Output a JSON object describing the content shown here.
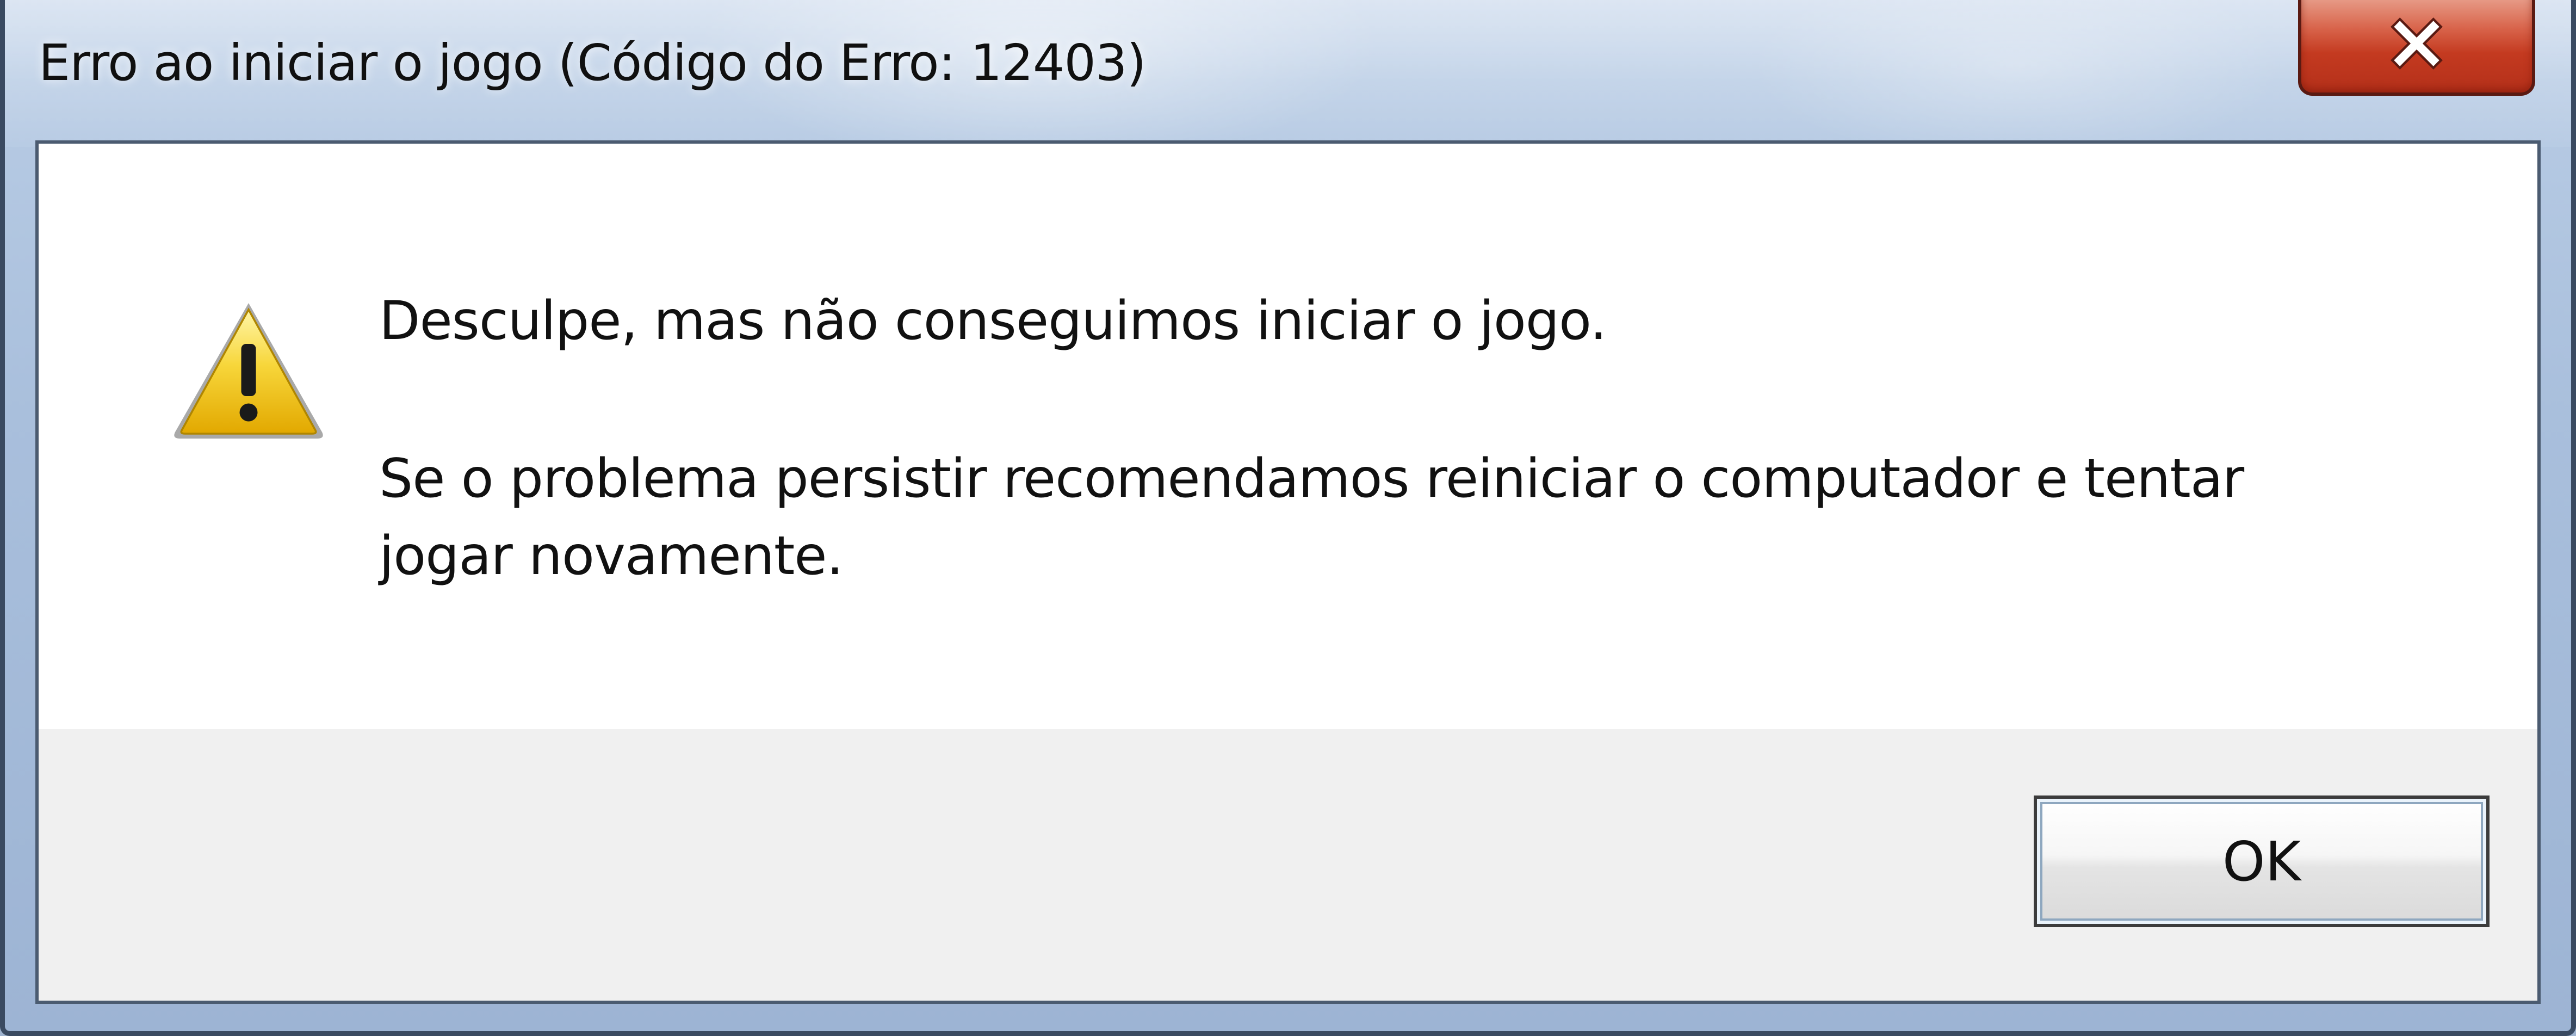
{
  "window": {
    "title": "Erro ao iniciar o jogo (Código do Erro: 12403)"
  },
  "titlebar": {
    "close_icon": "close-icon",
    "close_color": "#c43a20"
  },
  "dialog": {
    "icon": "warning-icon",
    "icon_color": "#f2c200",
    "message_line1": "Desculpe, mas não conseguimos iniciar o jogo.",
    "message_line2": "Se o problema persistir recomendamos reiniciar o computador e tentar jogar novamente."
  },
  "footer": {
    "ok_label": "OK"
  }
}
